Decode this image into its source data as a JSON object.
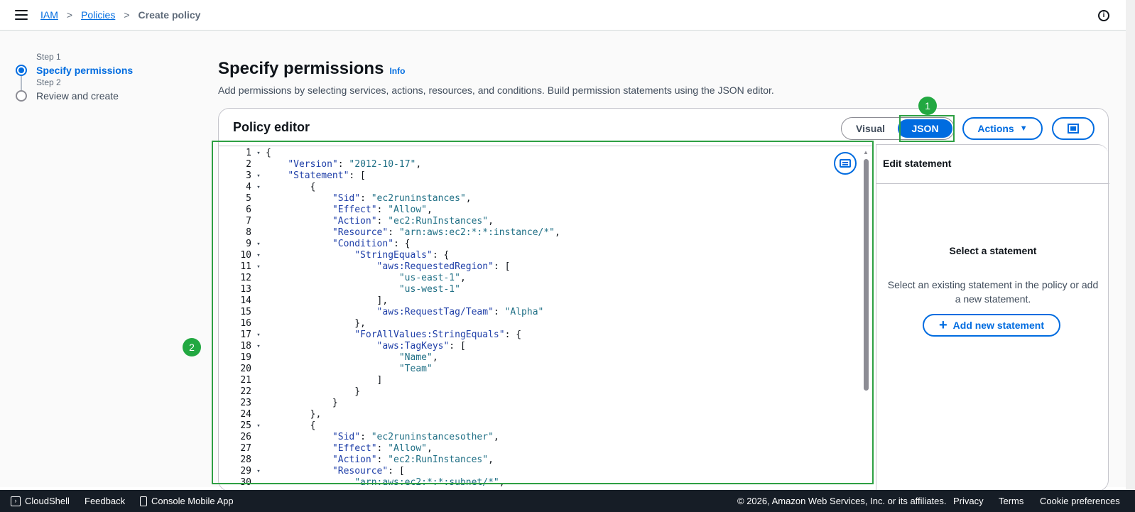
{
  "breadcrumb": {
    "items": [
      "IAM",
      "Policies"
    ],
    "current": "Create policy",
    "sep": ">"
  },
  "steps": [
    {
      "label": "Step 1",
      "title": "Specify permissions"
    },
    {
      "label": "Step 2",
      "title": "Review and create"
    }
  ],
  "header": {
    "title": "Specify permissions",
    "info": "Info",
    "description": "Add permissions by selecting services, actions, resources, and conditions. Build permission statements using the JSON editor."
  },
  "editor": {
    "title": "Policy editor",
    "modes": [
      "Visual",
      "JSON"
    ],
    "selected_mode": "JSON",
    "actions_label": "Actions",
    "lines": [
      "{",
      "    \"Version\": \"2012-10-17\",",
      "    \"Statement\": [",
      "        {",
      "            \"Sid\": \"ec2runinstances\",",
      "            \"Effect\": \"Allow\",",
      "            \"Action\": \"ec2:RunInstances\",",
      "            \"Resource\": \"arn:aws:ec2:*:*:instance/*\",",
      "            \"Condition\": {",
      "                \"StringEquals\": {",
      "                    \"aws:RequestedRegion\": [",
      "                        \"us-east-1\",",
      "                        \"us-west-1\"",
      "                    ],",
      "                    \"aws:RequestTag/Team\": \"Alpha\"",
      "                },",
      "                \"ForAllValues:StringEquals\": {",
      "                    \"aws:TagKeys\": [",
      "                        \"Name\",",
      "                        \"Team\"",
      "                    ]",
      "                }",
      "            }",
      "        },",
      "        {",
      "            \"Sid\": \"ec2runinstancesother\",",
      "            \"Effect\": \"Allow\",",
      "            \"Action\": \"ec2:RunInstances\",",
      "            \"Resource\": [",
      "                \"arn:aws:ec2:*:*:subnet/*\","
    ],
    "fold_lines": [
      1,
      3,
      4,
      9,
      10,
      11,
      17,
      18,
      25,
      29
    ],
    "fold_glyph": "▾"
  },
  "statement_panel": {
    "title": "Edit statement",
    "heading": "Select a statement",
    "description": "Select an existing statement in the policy or add a new statement.",
    "add_label": "Add new statement"
  },
  "annotations": [
    "1",
    "2"
  ],
  "footer": {
    "cloudshell": "CloudShell",
    "feedback": "Feedback",
    "mobile": "Console Mobile App",
    "copyright": "© 2026, Amazon Web Services, Inc. or its affiliates.",
    "privacy": "Privacy",
    "terms": "Terms",
    "cookies": "Cookie preferences"
  },
  "colors": {
    "accent": "#006ce0",
    "annotation": "#22a841",
    "footer_bg": "#161d26"
  }
}
